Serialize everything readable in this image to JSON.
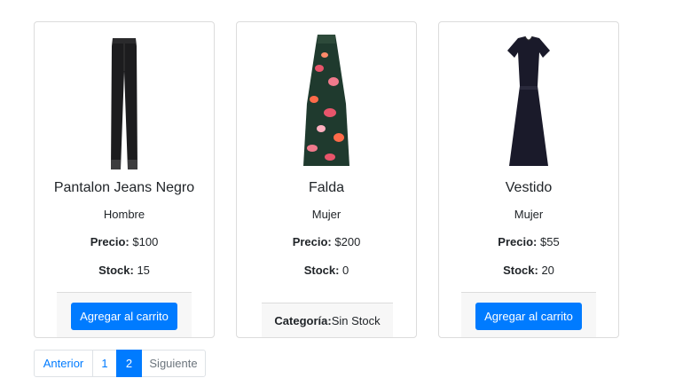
{
  "products": [
    {
      "name": "Pantalon Jeans Negro",
      "category": "Hombre",
      "price_label": "Precio:",
      "price": " $100",
      "stock_label": "Stock:",
      "stock": " 15",
      "button": "Agregar al carrito",
      "image_icon": "black-jeans-icon"
    },
    {
      "name": "Falda",
      "category": "Mujer",
      "price_label": "Precio:",
      "price": " $200",
      "stock_label": "Stock:",
      "stock": " 0",
      "footer_label": "Categoría:",
      "footer_value": " Sin Stock",
      "image_icon": "floral-skirt-icon"
    },
    {
      "name": "Vestido",
      "category": "Mujer",
      "price_label": "Precio:",
      "price": " $55",
      "stock_label": "Stock:",
      "stock": " 20",
      "button": "Agregar al carrito",
      "image_icon": "black-dress-icon"
    }
  ],
  "pagination": {
    "prev": "Anterior",
    "pages": [
      "1",
      "2"
    ],
    "active_page": "2",
    "next": "Siguiente"
  },
  "colors": {
    "primary": "#007bff",
    "border": "#dcdcdc",
    "footer_bg": "#f7f7f7"
  }
}
